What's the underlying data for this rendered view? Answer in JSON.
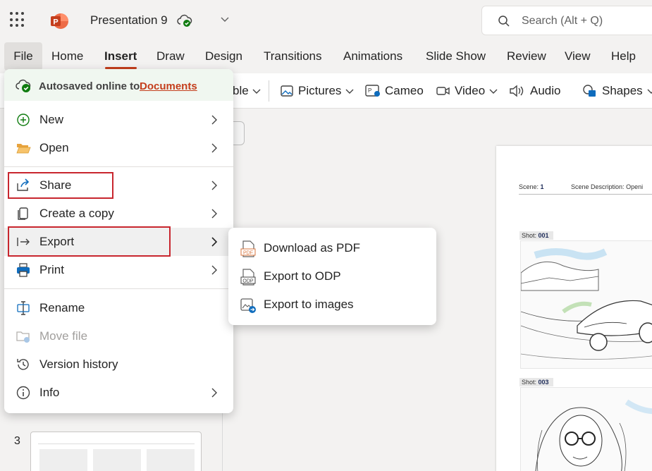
{
  "titlebar": {
    "doc_title": "Presentation 9",
    "search_placeholder": "Search (Alt + Q)"
  },
  "tabs": [
    {
      "label": "File"
    },
    {
      "label": "Home"
    },
    {
      "label": "Insert"
    },
    {
      "label": "Draw"
    },
    {
      "label": "Design"
    },
    {
      "label": "Transitions"
    },
    {
      "label": "Animations"
    },
    {
      "label": "Slide Show"
    },
    {
      "label": "Review"
    },
    {
      "label": "View"
    },
    {
      "label": "Help"
    }
  ],
  "ribbon": {
    "table_label": "ble",
    "pictures_label": "Pictures",
    "cameo_label": "Cameo",
    "video_label": "Video",
    "audio_label": "Audio",
    "shapes_label": "Shapes"
  },
  "file_menu": {
    "autosave_text": "Autosaved online to",
    "autosave_link": "Documents",
    "items": [
      {
        "label": "New"
      },
      {
        "label": "Open"
      },
      {
        "label": "Share"
      },
      {
        "label": "Create a copy"
      },
      {
        "label": "Export"
      },
      {
        "label": "Print"
      },
      {
        "label": "Rename"
      },
      {
        "label": "Move file"
      },
      {
        "label": "Version history"
      },
      {
        "label": "Info"
      }
    ]
  },
  "export_submenu": {
    "items": [
      {
        "label": "Download as PDF"
      },
      {
        "label": "Export to ODP"
      },
      {
        "label": "Export to images"
      }
    ]
  },
  "slide_pane": {
    "slide_number": "3"
  },
  "slide": {
    "scene_label": "Scene:",
    "scene_value": "1",
    "scene_desc_label": "Scene Description:",
    "scene_desc_value": "Openi",
    "shot1_label": "Shot:",
    "shot1_value": "001",
    "shot2_label": "Shot:",
    "shot2_value": "003"
  },
  "colors": {
    "accent": "#c43e1c",
    "highlight_box": "#c8262e",
    "autosave_bg": "#f0f7f0"
  }
}
